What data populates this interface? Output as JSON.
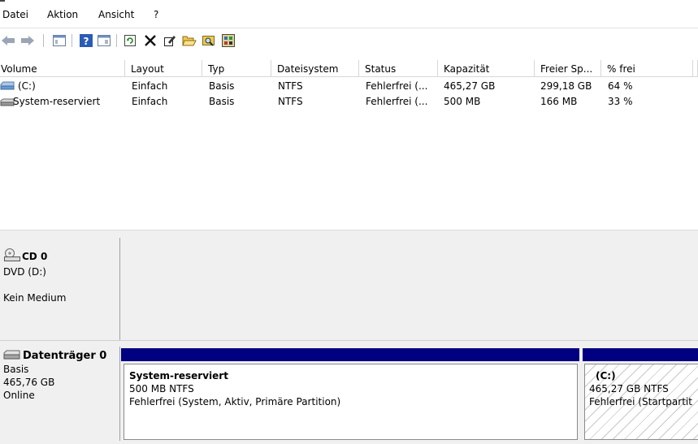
{
  "menu": {
    "items": [
      "Datei",
      "Aktion",
      "Ansicht",
      "?"
    ]
  },
  "toolbar": {
    "icons": [
      "back-arrow-icon",
      "forward-arrow-icon",
      "console-tree-icon",
      "help-icon",
      "properties-icon",
      "refresh-icon",
      "delete-icon",
      "edit-icon",
      "open-folder-icon",
      "explore-icon",
      "properties-sheet-icon"
    ]
  },
  "volumes": {
    "columns": [
      "Volume",
      "Layout",
      "Typ",
      "Dateisystem",
      "Status",
      "Kapazität",
      "Freier Sp...",
      "% frei"
    ],
    "rows": [
      [
        "(C:)",
        "Einfach",
        "Basis",
        "NTFS",
        "Fehlerfrei (...",
        "465,27 GB",
        "299,18 GB",
        "64 %"
      ],
      [
        "System-reserviert",
        "Einfach",
        "Basis",
        "NTFS",
        "Fehlerfrei (...",
        "500 MB",
        "166 MB",
        "33 %"
      ]
    ]
  },
  "disks": {
    "cd": {
      "name": "CD 0",
      "drive": "DVD (D:)",
      "status": "Kein Medium"
    },
    "disk0": {
      "name": "Datenträger 0",
      "type": "Basis",
      "size": "465,76 GB",
      "status": "Online",
      "partitions": [
        {
          "name": "System-reserviert",
          "size": "500 MB NTFS",
          "status": "Fehlerfrei (System, Aktiv, Primäre Partition)"
        },
        {
          "name": "(C:)",
          "size": "465,27 GB NTFS",
          "status": "Fehlerfrei (Startpartit"
        }
      ]
    }
  },
  "colors": {
    "partition_bar": "#000080",
    "selection": "#cce8ff"
  }
}
